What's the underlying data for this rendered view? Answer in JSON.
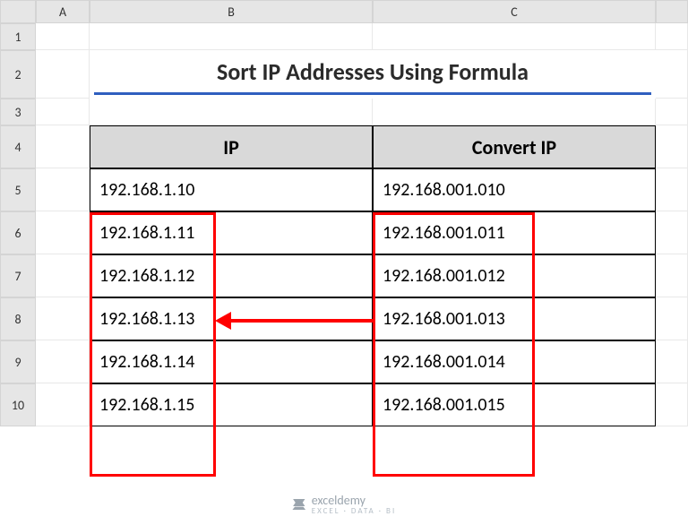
{
  "grid": {
    "col_headers": [
      "A",
      "B",
      "C"
    ],
    "row_headers": [
      "1",
      "2",
      "3",
      "4",
      "5",
      "6",
      "7",
      "8",
      "9",
      "10"
    ]
  },
  "title": "Sort IP Addresses Using Formula",
  "table": {
    "headers": {
      "ip": "IP",
      "convert": "Convert IP"
    },
    "rows": [
      {
        "ip": "192.168.1.10",
        "convert": "192.168.001.010"
      },
      {
        "ip": "192.168.1.11",
        "convert": "192.168.001.011"
      },
      {
        "ip": "192.168.1.12",
        "convert": "192.168.001.012"
      },
      {
        "ip": "192.168.1.13",
        "convert": "192.168.001.013"
      },
      {
        "ip": "192.168.1.14",
        "convert": "192.168.001.014"
      },
      {
        "ip": "192.168.1.15",
        "convert": "192.168.001.015"
      }
    ]
  },
  "watermark": {
    "name": "exceldemy",
    "sub": "EXCEL · DATA · BI"
  },
  "chart_data": {
    "type": "table",
    "title": "Sort IP Addresses Using Formula",
    "columns": [
      "IP",
      "Convert IP"
    ],
    "rows": [
      [
        "192.168.1.10",
        "192.168.001.010"
      ],
      [
        "192.168.1.11",
        "192.168.001.011"
      ],
      [
        "192.168.1.12",
        "192.168.001.012"
      ],
      [
        "192.168.1.13",
        "192.168.001.013"
      ],
      [
        "192.168.1.14",
        "192.168.001.014"
      ],
      [
        "192.168.1.15",
        "192.168.001.015"
      ]
    ]
  }
}
